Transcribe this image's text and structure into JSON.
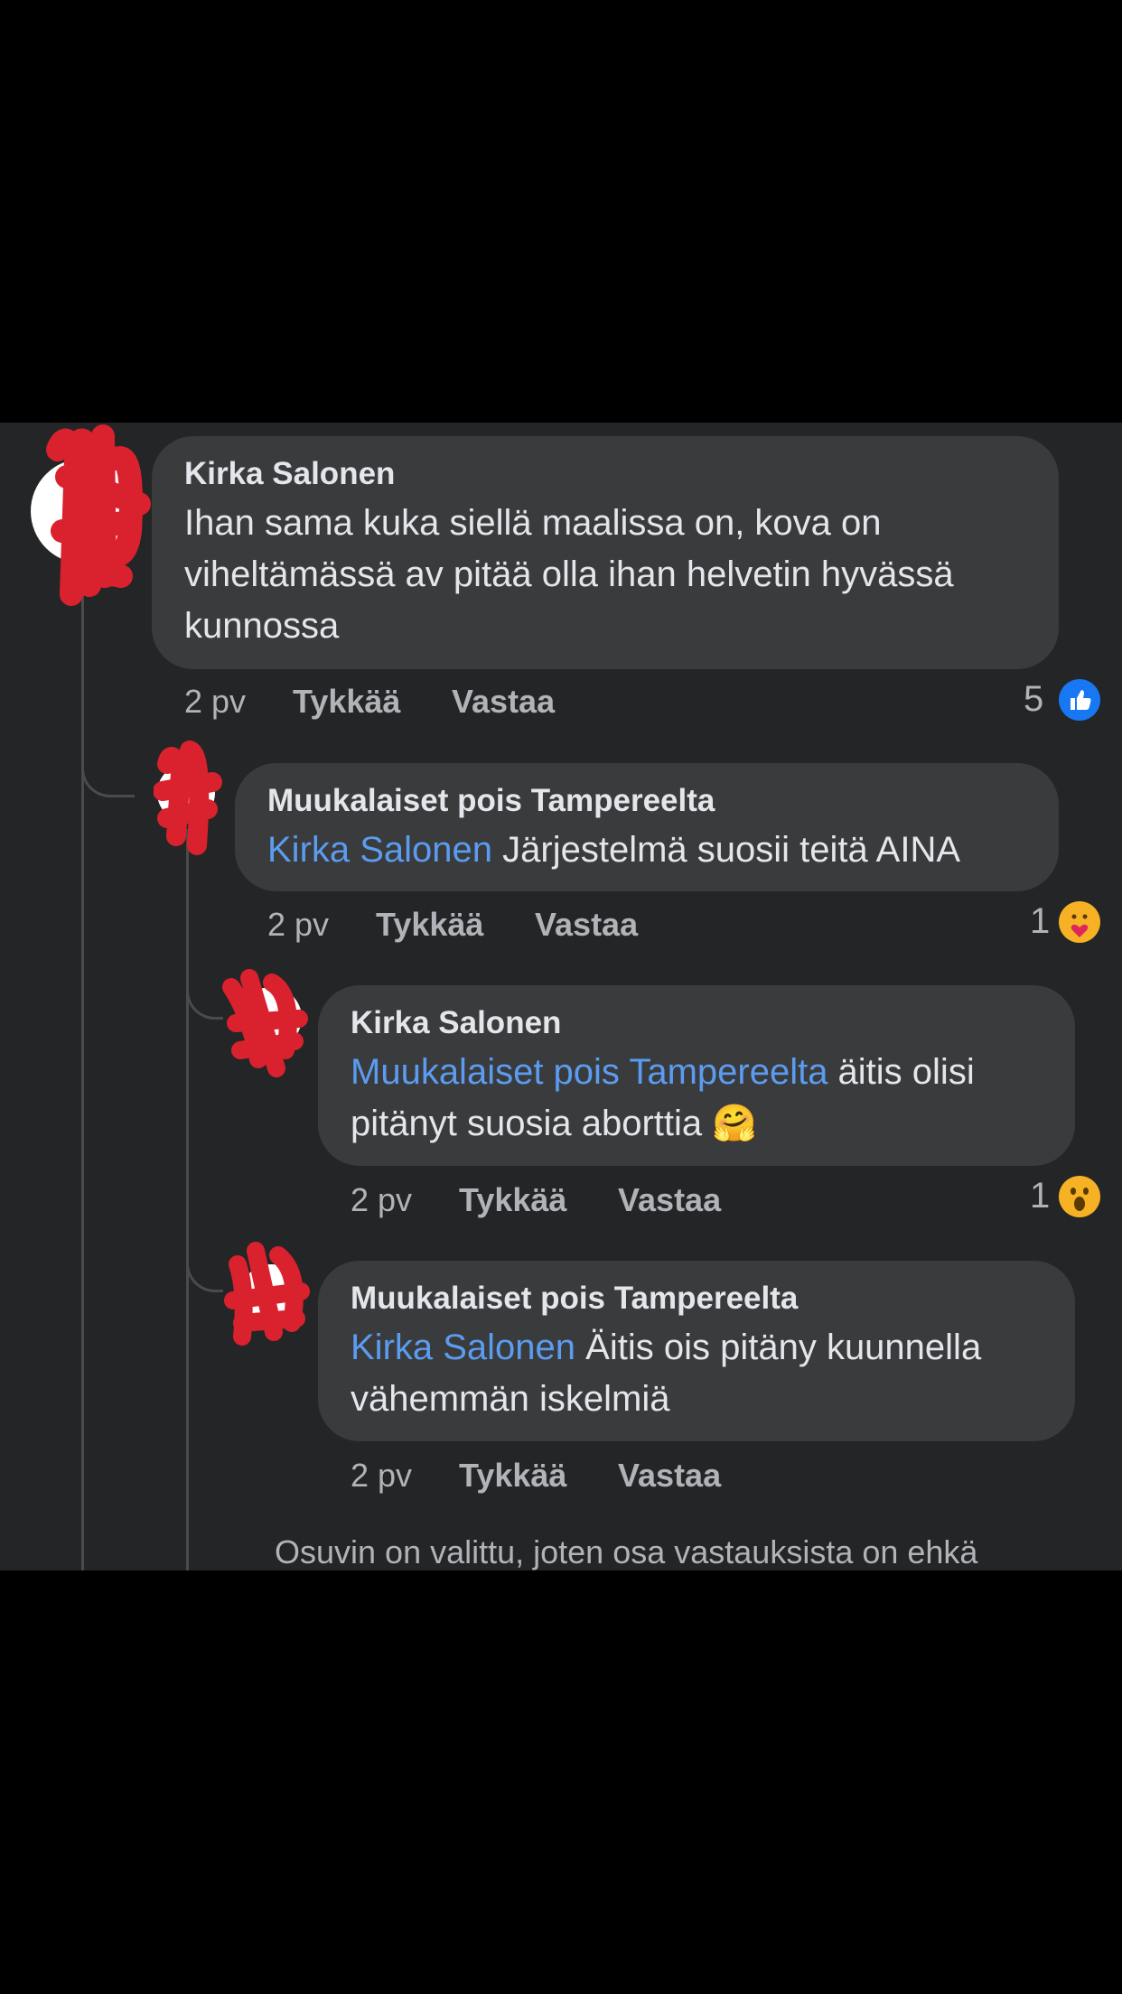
{
  "comments": [
    {
      "author": "Kirka Salonen",
      "text": "Ihan sama kuka siellä maalissa on, kova on viheltämässä av pitää olla ihan helvetin hyvässä kunnossa",
      "time": "2 pv",
      "like_label": "Tykkää",
      "reply_label": "Vastaa",
      "reaction_count": "5",
      "reaction_icon": "like-icon"
    },
    {
      "author": "Muukalaiset pois Tampereelta",
      "mention": "Kirka Salonen",
      "text": " Järjestelmä suosii teitä AINA",
      "time": "2 pv",
      "like_label": "Tykkää",
      "reply_label": "Vastaa",
      "reaction_count": "1",
      "reaction_icon": "care-icon"
    },
    {
      "author": "Kirka Salonen",
      "mention": "Muukalaiset pois Tampereelta",
      "text": " äitis olisi pitänyt suosia aborttia 🤗",
      "time": "2 pv",
      "like_label": "Tykkää",
      "reply_label": "Vastaa",
      "reaction_count": "1",
      "reaction_icon": "wow-icon"
    },
    {
      "author": "Muukalaiset pois Tampereelta",
      "mention": "Kirka Salonen",
      "text": " Äitis ois pitäny kuunnella vähemmän iskelmiä",
      "time": "2 pv",
      "like_label": "Tykkää",
      "reply_label": "Vastaa"
    }
  ],
  "footer_text": "Osuvin on valittu, joten osa vastauksista on ehkä",
  "colors": {
    "background": "#242526",
    "bubble": "#3a3b3c",
    "mention": "#5b9cf0",
    "redaction": "#d9222e",
    "like_blue": "#1877f2"
  }
}
